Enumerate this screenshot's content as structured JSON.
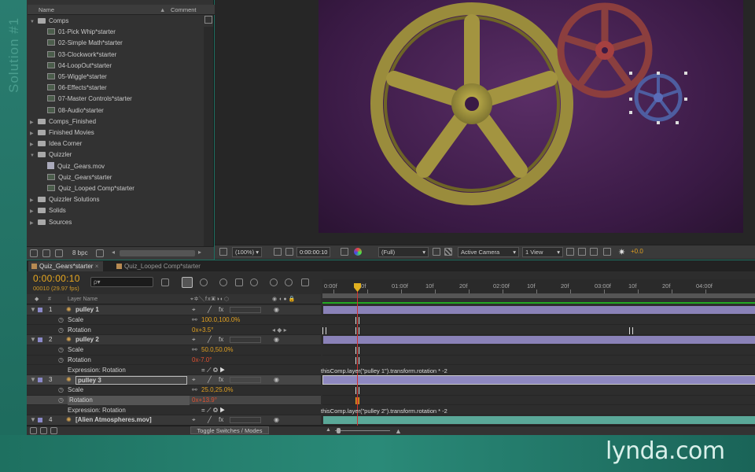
{
  "watermark": {
    "solution": "Solution #1",
    "brand": "lynda.com"
  },
  "project": {
    "headers": {
      "name": "Name",
      "comment": "Comment"
    },
    "items": [
      {
        "label": "Comps",
        "kind": "folder",
        "indent": 0,
        "open": true
      },
      {
        "label": "01-Pick Whip*starter",
        "kind": "comp",
        "indent": 2
      },
      {
        "label": "02-Simple Math*starter",
        "kind": "comp",
        "indent": 2
      },
      {
        "label": "03-Clockwork*starter",
        "kind": "comp",
        "indent": 2
      },
      {
        "label": "04-LoopOut*starter",
        "kind": "comp",
        "indent": 2
      },
      {
        "label": "05-Wiggle*starter",
        "kind": "comp",
        "indent": 2
      },
      {
        "label": "06-Effects*starter",
        "kind": "comp",
        "indent": 2
      },
      {
        "label": "07-Master Controls*starter",
        "kind": "comp",
        "indent": 2
      },
      {
        "label": "08-Audio*starter",
        "kind": "comp",
        "indent": 2
      },
      {
        "label": "Comps_Finished",
        "kind": "folder",
        "indent": 0
      },
      {
        "label": "Finished Movies",
        "kind": "folder",
        "indent": 0
      },
      {
        "label": "Idea Corner",
        "kind": "folder",
        "indent": 0
      },
      {
        "label": "Quizzler",
        "kind": "folder",
        "indent": 0,
        "open": true
      },
      {
        "label": "Quiz_Gears.mov",
        "kind": "mov",
        "indent": 1
      },
      {
        "label": "Quiz_Gears*starter",
        "kind": "comp",
        "indent": 1
      },
      {
        "label": "Quiz_Looped Comp*starter",
        "kind": "comp",
        "indent": 1
      },
      {
        "label": "Quizzler Solutions",
        "kind": "folder",
        "indent": 0
      },
      {
        "label": "Solids",
        "kind": "folder",
        "indent": 0
      },
      {
        "label": "Sources",
        "kind": "folder",
        "indent": 0
      }
    ],
    "footer": {
      "bpc": "8 bpc"
    }
  },
  "viewer": {
    "zoom": "(100%)",
    "time": "0:00:00:10",
    "resolution": "(Full)",
    "camera": "Active Camera",
    "view": "1 View",
    "exposure": "+0.0"
  },
  "timeline": {
    "tabs": [
      {
        "label": "Quiz_Gears*starter",
        "active": true
      },
      {
        "label": "Quiz_Looped Comp*starter",
        "active": false
      }
    ],
    "timecode": "0:00:00:10",
    "fps": "00010 (29.97 fps)",
    "search_placeholder": "ρ▾",
    "columns": {
      "num": "#",
      "layer_name": "Layer Name"
    },
    "ruler": [
      "0:00f",
      "20f",
      "01:00f",
      "10f",
      "20f",
      "02:00f",
      "10f",
      "20f",
      "03:00f",
      "10f",
      "20f",
      "04:00f"
    ],
    "rows": [
      {
        "type": "layer",
        "num": "1",
        "name": "pulley 1"
      },
      {
        "type": "prop",
        "name": "Scale",
        "value": "100.0,100.0%"
      },
      {
        "type": "prop",
        "name": "Rotation",
        "value": "0x+3.5°"
      },
      {
        "type": "layer",
        "num": "2",
        "name": "pulley 2"
      },
      {
        "type": "prop",
        "name": "Scale",
        "value": "50.0,50.0%"
      },
      {
        "type": "prop",
        "name": "Rotation",
        "value": "0x-7.0°",
        "red": true
      },
      {
        "type": "expr",
        "name": "Expression: Rotation",
        "code": "thisComp.layer(\"pulley 1\").transform.rotation * -2"
      },
      {
        "type": "layer",
        "num": "3",
        "name": "pulley 3",
        "selected": true
      },
      {
        "type": "prop",
        "name": "Scale",
        "value": "25.0,25.0%"
      },
      {
        "type": "prop",
        "name": "Rotation",
        "value": "0x+13.9°",
        "red": true,
        "selected": true
      },
      {
        "type": "expr",
        "name": "Expression: Rotation",
        "code": "thisComp.layer(\"pulley 2\").transform.rotation * -2"
      },
      {
        "type": "layer",
        "num": "4",
        "name": "[Alien Atmospheres.mov]"
      }
    ],
    "toggle_label": "Toggle Switches / Modes"
  },
  "colors": {
    "timecode": "#e8a820",
    "layer_bar": "#8a82b8",
    "cti": "#d23030",
    "work_area": "#23a923"
  }
}
